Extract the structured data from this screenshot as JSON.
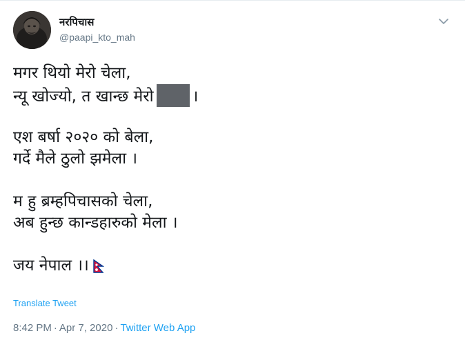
{
  "author": {
    "display_name": "नरपिचास",
    "handle": "@paapi_kto_mah"
  },
  "tweet": {
    "stanzas": [
      {
        "lines": [
          "मगर थियो मेरो चेला,",
          "न्यू खोज्यो, त खान्छ मेरो"
        ],
        "line2_suffix": "।"
      },
      {
        "lines": [
          "एश बर्षा २०२० को बेला,",
          "गर्दे मैले ठुलो झमेला ।"
        ]
      },
      {
        "lines": [
          "म हु ब्रम्हपिचासको चेला,",
          "अब हुन्छ कान्डहारुको मेला ।"
        ]
      },
      {
        "lines": [
          "जय नेपाल ।।"
        ]
      }
    ],
    "flag_icon": "nepal-flag-icon",
    "translate_label": "Translate Tweet",
    "time": "8:42 PM",
    "separator": "·",
    "date": "Apr 7, 2020",
    "source": "Twitter Web App"
  },
  "colors": {
    "text": "#14171a",
    "secondary": "#657786",
    "link": "#1da1f2",
    "redaction": "#5f6368"
  }
}
